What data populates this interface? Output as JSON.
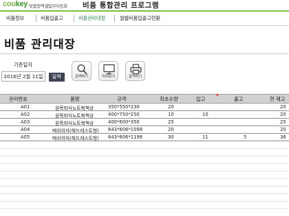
{
  "header": {
    "logo_main": "cou",
    "logo_accent": "key",
    "logo_sub": "맞춤형엑셀업무자동화",
    "app_title": "비품 통합관리 프로그램"
  },
  "nav": {
    "items": [
      {
        "label": "비품정보"
      },
      {
        "label": "비품입출고"
      },
      {
        "label": "비품관리대장"
      },
      {
        "label": "월별비품입출고현황"
      }
    ],
    "active_index": 2
  },
  "page": {
    "title": "비품 관리대장"
  },
  "filter": {
    "date_label": "기준일자",
    "date_value": "2016년 2월 11일",
    "calendar_button": "달력"
  },
  "toolbar": {
    "search_label": "검색하기",
    "preview_label": "미리보기",
    "print_label": "출력하기"
  },
  "table": {
    "headers": [
      "관리번호",
      "품명",
      "규격",
      "최초수량",
      "입고",
      "출고",
      "현 재고"
    ],
    "rows": [
      {
        "id": "A01",
        "name": "원목좌식노트북책상",
        "spec": "350*550*230",
        "initial": "20",
        "in": "",
        "out": "",
        "stock": "20"
      },
      {
        "id": "A02",
        "name": "원목좌식노트북책상",
        "spec": "400*750*250",
        "initial": "10",
        "in": "10",
        "out": "",
        "stock": "20"
      },
      {
        "id": "A03",
        "name": "원목좌식노트북책상",
        "spec": "400*600*350",
        "initial": "25",
        "in": "",
        "out": "",
        "stock": "25"
      },
      {
        "id": "A04",
        "name": "메쉬의자(헤드레스트형)",
        "spec": "643*606*1098",
        "initial": "20",
        "in": "",
        "out": "",
        "stock": "20"
      },
      {
        "id": "A05",
        "name": "메쉬의자(헤드레스트형)",
        "spec": "643*606*1198",
        "initial": "30",
        "in": "11",
        "out": "5",
        "stock": "36"
      }
    ]
  },
  "colors": {
    "accent_green": "#7cbf3e",
    "header_gray": "#d2d2d2",
    "button_dark": "#3d4552"
  }
}
